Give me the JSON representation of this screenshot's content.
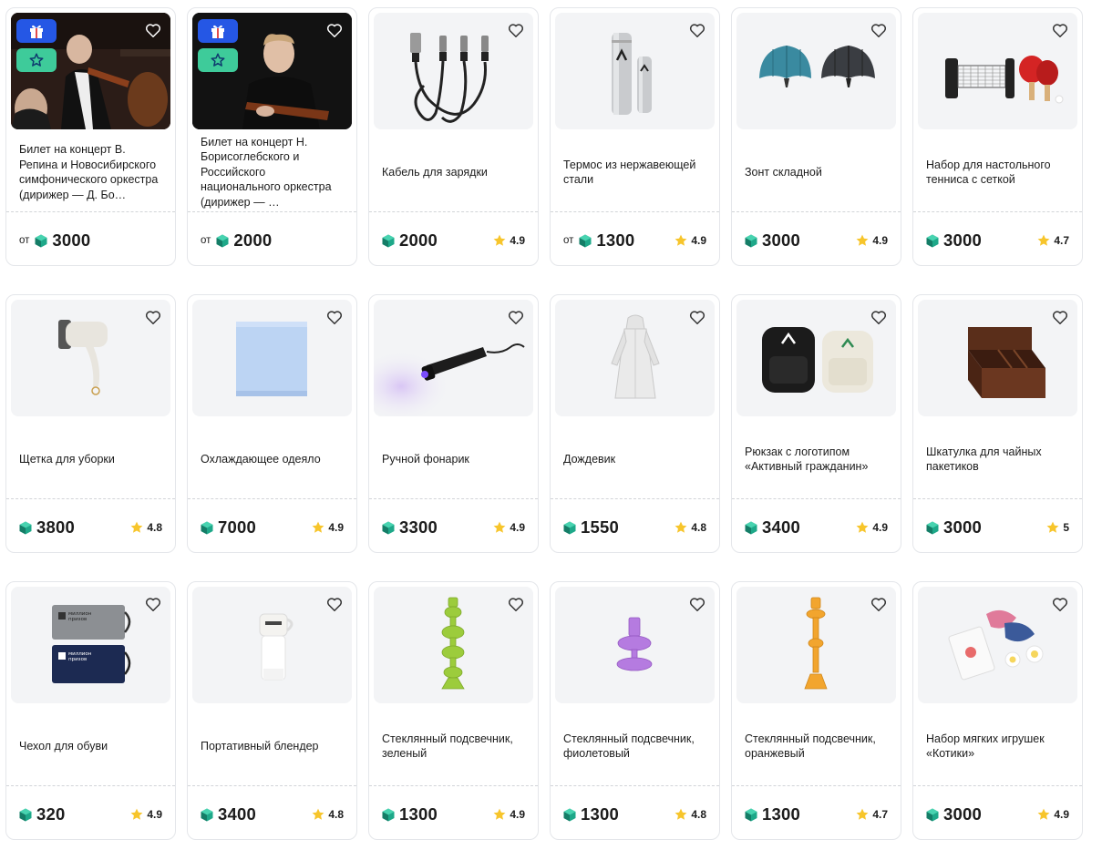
{
  "currency_icon": "green-gem-coin-icon",
  "products": [
    {
      "title": "Билет на концерт В. Репина и Новосибирского симфонического оркестра (дирижер — Д. Бо…",
      "from": "от",
      "price": "3000",
      "rating": "",
      "image": "orchestra-violinist-photo",
      "badges": [
        "gift-icon",
        "star-icon"
      ]
    },
    {
      "title": "Билет на концерт Н. Борисоглебского и Российского национального оркестра (дирижер — …",
      "from": "от",
      "price": "2000",
      "rating": "",
      "image": "violinist-portrait-photo",
      "badges": [
        "gift-icon",
        "star-icon"
      ]
    },
    {
      "title": "Кабель для зарядки",
      "from": "",
      "price": "2000",
      "rating": "4.9",
      "image": "charging-cable"
    },
    {
      "title": "Термос из нержавеющей стали",
      "from": "от",
      "price": "1300",
      "rating": "4.9",
      "image": "steel-thermos"
    },
    {
      "title": "Зонт складной",
      "from": "",
      "price": "3000",
      "rating": "4.9",
      "image": "folding-umbrella"
    },
    {
      "title": "Набор для настольного тенниса с сеткой",
      "from": "",
      "price": "3000",
      "rating": "4.7",
      "image": "table-tennis-set"
    },
    {
      "title": "Щетка для уборки",
      "from": "",
      "price": "3800",
      "rating": "4.8",
      "image": "cleaning-brush"
    },
    {
      "title": "Охлаждающее одеяло",
      "from": "",
      "price": "7000",
      "rating": "4.9",
      "image": "cooling-blanket"
    },
    {
      "title": "Ручной фонарик",
      "from": "",
      "price": "3300",
      "rating": "4.9",
      "image": "flashlight"
    },
    {
      "title": "Дождевик",
      "from": "",
      "price": "1550",
      "rating": "4.8",
      "image": "raincoat"
    },
    {
      "title": "Рюкзак с логотипом «Активный гражданин»",
      "from": "",
      "price": "3400",
      "rating": "4.9",
      "image": "backpacks"
    },
    {
      "title": "Шкатулка для чайных пакетиков",
      "from": "",
      "price": "3000",
      "rating": "5",
      "image": "tea-box"
    },
    {
      "title": "Чехол для обуви",
      "from": "",
      "price": "320",
      "rating": "4.9",
      "image": "shoe-cover",
      "art_text": [
        "миллион",
        "призов"
      ]
    },
    {
      "title": "Портативный блендер",
      "from": "",
      "price": "3400",
      "rating": "4.8",
      "image": "portable-blender"
    },
    {
      "title": "Стеклянный подсвечник, зеленый",
      "from": "",
      "price": "1300",
      "rating": "4.9",
      "image": "candlestick-green",
      "color": "#9ccc3c"
    },
    {
      "title": "Стеклянный подсвечник, фиолетовый",
      "from": "",
      "price": "1300",
      "rating": "4.8",
      "image": "candlestick-purple",
      "color": "#b57be0"
    },
    {
      "title": "Стеклянный подсвечник, оранжевый",
      "from": "",
      "price": "1300",
      "rating": "4.7",
      "image": "candlestick-orange",
      "color": "#f2a52e"
    },
    {
      "title": "Набор мягких игрушек «Котики»",
      "from": "",
      "price": "3000",
      "rating": "4.9",
      "image": "plush-cats"
    }
  ]
}
